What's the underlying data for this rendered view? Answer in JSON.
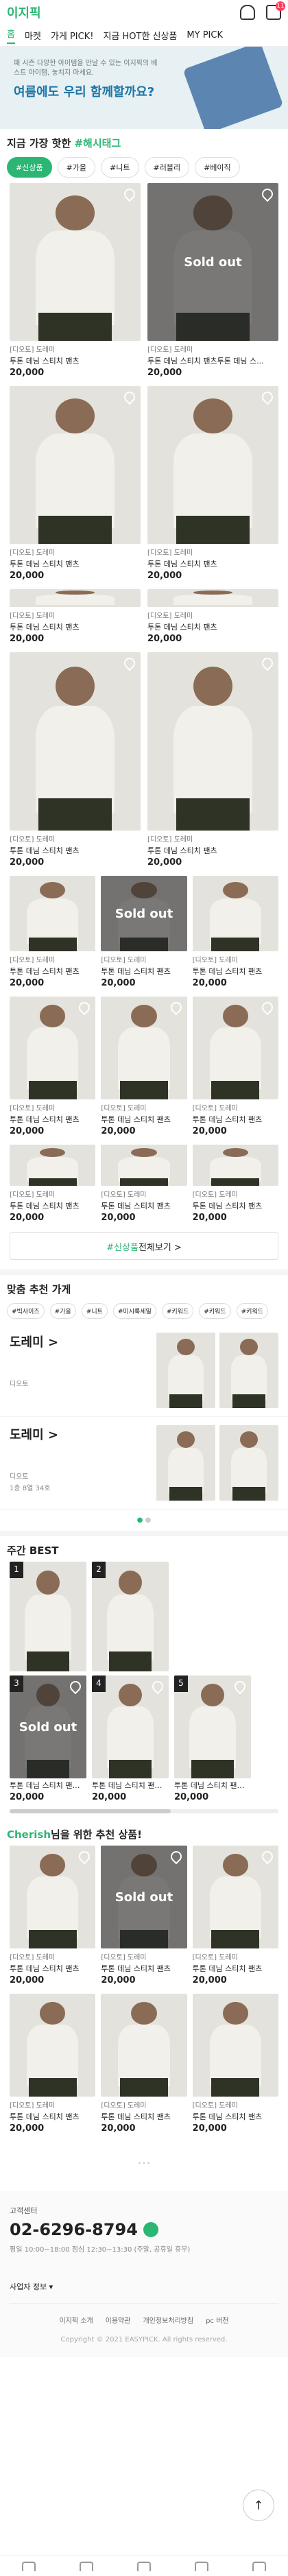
{
  "app": {
    "logo": "이지픽",
    "cart_count": "11"
  },
  "tabs": [
    "홈",
    "마켓",
    "가게 PICK!",
    "지금 HOT한 신상품",
    "MY PICK"
  ],
  "banner": {
    "sub": "패 시즌 다양한 아이템을 만날 수 있는 이지픽의 베스트 아이템, 놓치지 마세요.",
    "main": "여름에도 우리 함께할까요?"
  },
  "hashtag": {
    "title_prefix": "지금 가장 핫한",
    "title_hl": "#해시태그",
    "chips": [
      "#신상품",
      "#가을",
      "#니트",
      "#러블리",
      "#베이직"
    ]
  },
  "product": {
    "store": "[디오토] 도레미",
    "name": "투톤 데님 스티치 팬츠",
    "name_long": "투톤 데님 스티치 팬츠투톤 데님 스...",
    "price": "20,000",
    "soldout": "Sold out"
  },
  "more": {
    "hl": "#신상품",
    "rest": " 전체보기 >"
  },
  "stores": {
    "title": "맞춤 추천 가게",
    "tags": [
      "#빅사이즈",
      "#가을",
      "#니트",
      "#미시룩세일",
      "#키워드",
      "#키워드",
      "#키워드"
    ],
    "list": [
      {
        "name": "도레미 >",
        "loc": "디오토",
        "extra": ""
      },
      {
        "name": "도레미 >",
        "loc": "디오토",
        "extra": "1층 8열 34호"
      }
    ]
  },
  "best": {
    "title": "주간 BEST",
    "ranks": [
      "1",
      "2",
      "3",
      "4",
      "5"
    ]
  },
  "reco": {
    "user": "Cherish",
    "title": "님을 위한 추천 상품!"
  },
  "footer": {
    "cs": "고객센터",
    "tel": "02-6296-8794",
    "hours": "평일 10:00~18:00   점심 12:30~13:30 (주말, 공휴일 휴무)",
    "biz": "사업자 정보 ▾",
    "links": [
      "이지픽 소개",
      "이용약관",
      "개인정보처리방침",
      "pc 버전"
    ],
    "copy": "Copyright © 2021 EASYPICK. All rights reserved."
  },
  "colors": {
    "accent": "#2bb673",
    "soldout_overlay": "#282828"
  }
}
